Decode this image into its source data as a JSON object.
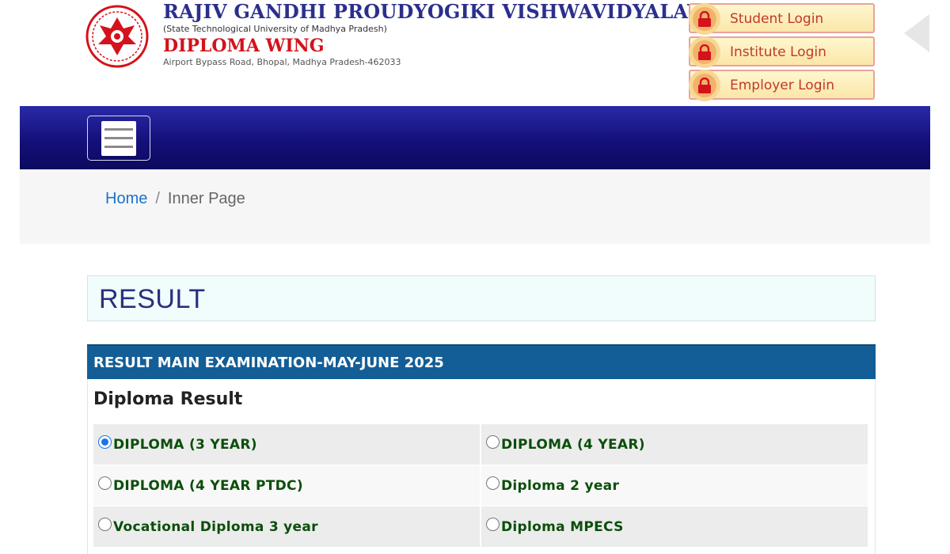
{
  "header": {
    "university_name": "RAJIV GANDHI PROUDYOGIKI VISHWAVIDYALAYA",
    "university_sub": "(State Technological University of Madhya Pradesh)",
    "wing": "DIPLOMA WING",
    "address": "Airport Bypass Road, Bhopal, Madhya Pradesh-462033",
    "logo_icon": "rgpv-emblem-icon"
  },
  "logins": [
    {
      "label": "Student Login",
      "icon": "lock-icon"
    },
    {
      "label": "Institute Login",
      "icon": "lock-icon"
    },
    {
      "label": "Employer Login",
      "icon": "lock-icon"
    }
  ],
  "navbar": {
    "menu_icon": "hamburger-menu-icon"
  },
  "breadcrumb": {
    "home": "Home",
    "separator": "/",
    "current": "Inner Page"
  },
  "page_title": "RESULT",
  "panel": {
    "heading": "RESULT MAIN EXAMINATION-MAY-JUNE 2025",
    "title": "Diploma Result",
    "options": [
      {
        "label": "DIPLOMA (3 YEAR)",
        "checked": true
      },
      {
        "label": "DIPLOMA (4 YEAR)",
        "checked": false
      },
      {
        "label": "DIPLOMA (4 YEAR PTDC)",
        "checked": false
      },
      {
        "label": "Diploma 2 year",
        "checked": false
      },
      {
        "label": "Vocational Diploma 3 year",
        "checked": false
      },
      {
        "label": "Diploma MPECS",
        "checked": false
      }
    ]
  },
  "colors": {
    "brand_blue": "#2b2f8c",
    "wing_red": "#d4121b",
    "navbar": "#14107a",
    "panel_head": "#135e96",
    "option_text": "#0b4e0b",
    "link": "#1a73c9"
  }
}
